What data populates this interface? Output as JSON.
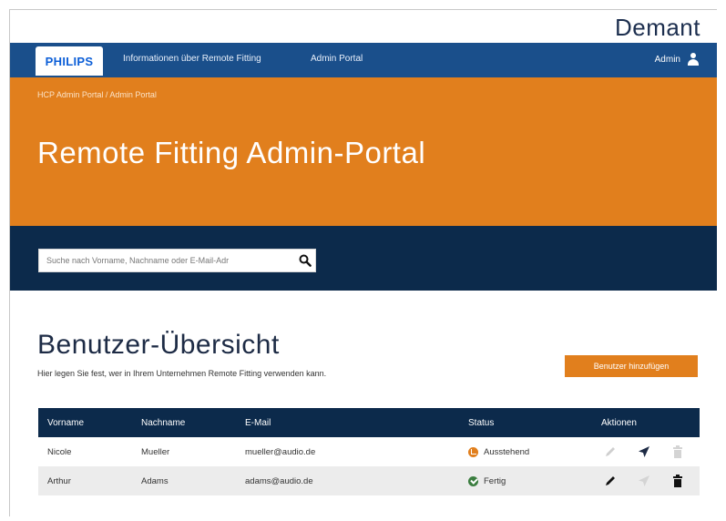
{
  "brand": {
    "company": "Demant",
    "logo": "PHILIPS"
  },
  "nav": {
    "links": [
      "Informationen über Remote Fitting",
      "Admin Portal"
    ],
    "user_label": "Admin",
    "user_icon": "user-icon"
  },
  "hero": {
    "breadcrumb": "HCP Admin Portal / Admin Portal",
    "title": "Remote Fitting Admin-Portal"
  },
  "search": {
    "placeholder": "Suche nach Vorname, Nachname oder E-Mail-Adr",
    "icon": "search-icon"
  },
  "overview": {
    "title": "Benutzer-Übersicht",
    "subtitle": "Hier legen Sie fest, wer in Ihrem Unternehmen Remote Fitting verwenden kann.",
    "add_button": "Benutzer hinzufügen"
  },
  "table": {
    "headers": [
      "Vorname",
      "Nachname",
      "E-Mail",
      "Status",
      "Aktionen"
    ],
    "rows": [
      {
        "first": "Nicole",
        "last": "Mueller",
        "email": "mueller@audio.de",
        "status": "Ausstehend",
        "status_type": "pending",
        "edit_enabled": false,
        "send_enabled": true,
        "delete_enabled": false
      },
      {
        "first": "Arthur",
        "last": "Adams",
        "email": "adams@audio.de",
        "status": "Fertig",
        "status_type": "done",
        "edit_enabled": true,
        "send_enabled": false,
        "delete_enabled": true
      }
    ]
  },
  "colors": {
    "nav": "#1a4f8b",
    "accent": "#e17f1d",
    "dark": "#0c2a4b",
    "pending": "#e17f1d",
    "done": "#3a7d3f"
  }
}
